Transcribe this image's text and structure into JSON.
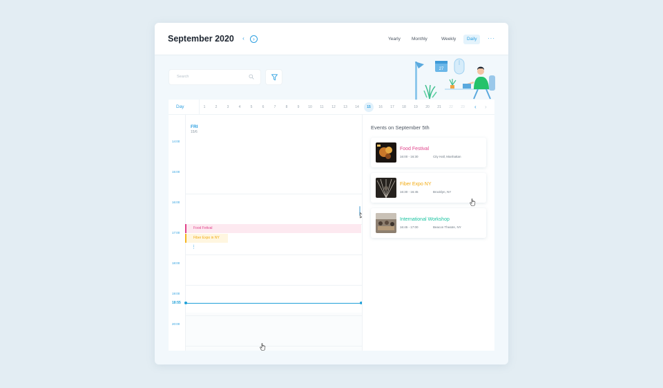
{
  "header": {
    "title": "September 2020",
    "views": [
      {
        "label": "Yearly"
      },
      {
        "label": "Monthly"
      },
      {
        "label": "Weekly"
      },
      {
        "label": "Daily"
      }
    ],
    "active_view": "Daily",
    "more_icon": "more-horizontal-icon"
  },
  "toolbar": {
    "search_placeholder": "Search",
    "search_icon": "search-icon",
    "filter_icon": "filter-icon"
  },
  "illustration": {
    "calendar_badge": "27"
  },
  "day_strip": {
    "label": "Day",
    "days": [
      "1",
      "2",
      "3",
      "4",
      "5",
      "6",
      "7",
      "8",
      "9",
      "10",
      "11",
      "12",
      "13",
      "14",
      "15",
      "16",
      "17",
      "18",
      "19",
      "20",
      "21",
      "22",
      "23"
    ],
    "selected": "15",
    "dimmed": [
      "22",
      "23"
    ]
  },
  "day_view": {
    "day_name": "FRI",
    "date": "15/6",
    "hours": [
      "14:00",
      "15:00",
      "16:00",
      "17:00",
      "18:00",
      "19:00",
      "20:00"
    ],
    "current_time": "18:55",
    "events": [
      {
        "label": "Food Fetival"
      },
      {
        "label": "Fiber Expo in NY"
      }
    ],
    "more_icon": "more-vertical-icon"
  },
  "events_panel": {
    "title": "Events on September 5th",
    "cards": [
      {
        "title": "Food Festival",
        "time": "16:00 - 16:30",
        "location": "City Hall, Manhattan",
        "color": "#e0428a"
      },
      {
        "title": "Fiber Expo NY",
        "time": "16:30 - 16:45",
        "location": "Brooklyn, NY",
        "color": "#f2a90e"
      },
      {
        "title": "International Workshop",
        "time": "16:45 - 17:00",
        "location": "Beacon Theatre, NY",
        "color": "#19c3a0"
      }
    ]
  },
  "colors": {
    "accent": "#2b9fe0",
    "background": "#e3edf3",
    "food": "#e0428a",
    "fiber": "#f2a90e",
    "workshop": "#19c3a0"
  }
}
